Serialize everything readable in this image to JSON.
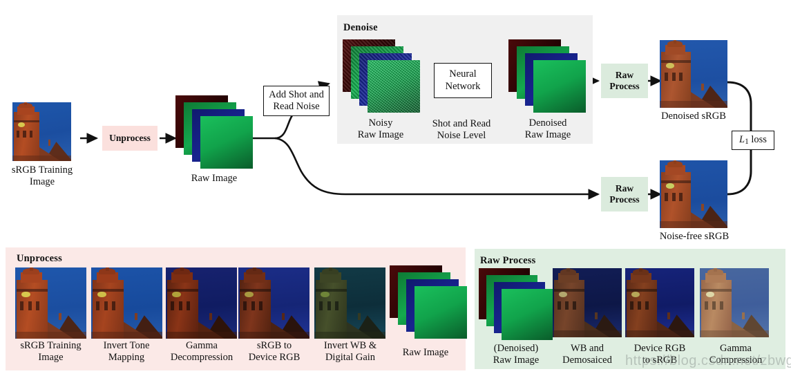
{
  "figure": {
    "kind": "pipeline-diagram",
    "title_visible": false,
    "watermark": "https://blog.csdn.net/zbwgycm"
  },
  "colors": {
    "unprocess_panel": "#fbe9e7",
    "unprocess_box": "#fbe0dd",
    "rawprocess_panel": "#dfeee1",
    "rawprocess_box": "#dbebdd",
    "denoise_panel": "#f0f0f0",
    "box_border": "#111111",
    "arrow": "#111111",
    "sky_srgb": "#1b4ea0",
    "sky_gamma": "#101f6e",
    "sky_device": "#15317f",
    "sky_invertwb": "#123a46",
    "sky_wb_demosaic": "#101c55",
    "sky_gamma_comp": "#42629e",
    "brick": "#a8441f",
    "raw_green": "#119944",
    "raw_red": "#3c0606",
    "raw_blue": "#131f80"
  },
  "main_flow": {
    "input": {
      "caption_line1": "sRGB Training",
      "caption_line2": "Image"
    },
    "unprocess_box": {
      "label": "Unprocess"
    },
    "raw_image": {
      "caption": "Raw Image"
    },
    "add_noise_box": {
      "line1": "Add Shot and",
      "line2": "Read Noise"
    },
    "denoise_panel": {
      "title": "Denoise",
      "noisy": {
        "caption_line1": "Noisy",
        "caption_line2": "Raw Image"
      },
      "network_box": {
        "line1": "Neural",
        "line2": "Network"
      },
      "noise_level": {
        "caption_line1": "Shot and Read",
        "caption_line2": "Noise Level"
      },
      "denoised": {
        "caption_line1": "Denoised",
        "caption_line2": "Raw Image"
      }
    },
    "raw_process_top": {
      "line1": "Raw",
      "line2": "Process"
    },
    "denoised_srgb": {
      "caption": "Denoised sRGB"
    },
    "raw_process_bottom": {
      "line1": "Raw",
      "line2": "Process"
    },
    "noise_free_srgb": {
      "caption": "Noise-free sRGB"
    },
    "loss_box": {
      "symbol": "L",
      "subscript": "1",
      "label": " loss",
      "full": "L1 loss"
    }
  },
  "unprocess_panel": {
    "title": "Unprocess",
    "steps": [
      {
        "line1": "sRGB Training",
        "line2": "Image",
        "type": "photo"
      },
      {
        "line1": "Invert Tone",
        "line2": "Mapping",
        "type": "photo"
      },
      {
        "line1": "Gamma",
        "line2": "Decompression",
        "type": "photo"
      },
      {
        "line1": "sRGB to",
        "line2": "Device RGB",
        "type": "photo"
      },
      {
        "line1": "Invert WB &",
        "line2": "Digital Gain",
        "type": "photo"
      },
      {
        "line1": "Raw Image",
        "line2": "",
        "type": "stack"
      }
    ]
  },
  "raw_process_panel": {
    "title": "Raw Process",
    "steps": [
      {
        "line1": "(Denoised)",
        "line2": "Raw Image",
        "type": "stack"
      },
      {
        "line1": "WB and",
        "line2": "Demosaiced",
        "type": "photo"
      },
      {
        "line1": "Device RGB",
        "line2": "to sRGB",
        "type": "photo"
      },
      {
        "line1": "Gamma",
        "line2": "Compression",
        "type": "photo"
      }
    ]
  }
}
